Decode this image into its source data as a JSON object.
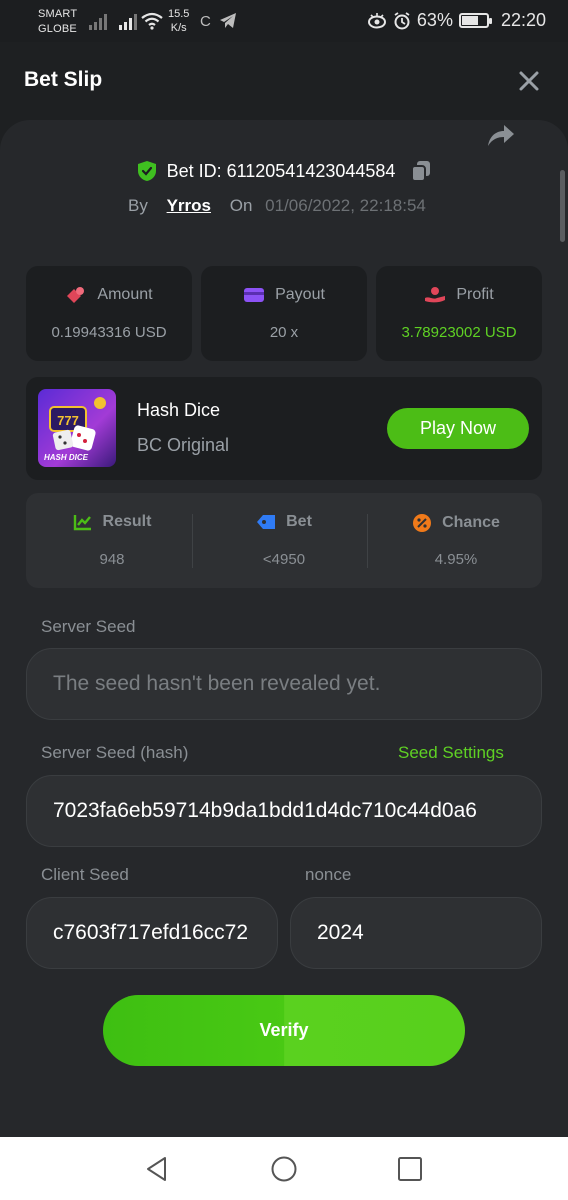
{
  "status_bar": {
    "carrier_line1": "SMART",
    "carrier_line2": "GLOBE",
    "speed_value": "15.5",
    "speed_unit": "K/s",
    "extra_letter": "C",
    "battery": "63%",
    "time": "22:20"
  },
  "header": {
    "title": "Bet Slip"
  },
  "bet": {
    "id_text": "Bet ID: 61120541423044584",
    "by_label": "By",
    "user": "Yrros",
    "on_label": "On",
    "date": "01/06/2022, 22:18:54"
  },
  "stats": [
    {
      "label": "Amount",
      "value": "0.19943316 USD",
      "icon": "coins-icon"
    },
    {
      "label": "Payout",
      "value": "20 x",
      "icon": "card-icon"
    },
    {
      "label": "Profit",
      "value": "3.78923002 USD",
      "icon": "hand-coin-icon"
    }
  ],
  "game": {
    "name": "Hash Dice",
    "subtitle": "BC Original",
    "thumb_text": "HASH DICE",
    "play_label": "Play Now"
  },
  "results": [
    {
      "label": "Result",
      "value": "948",
      "icon": "chart-icon",
      "color": "#4cbd16"
    },
    {
      "label": "Bet",
      "value": "<4950",
      "icon": "tag-icon",
      "color": "#2f7bf5"
    },
    {
      "label": "Chance",
      "value": "4.95%",
      "icon": "percent-icon",
      "color": "#f07a1a"
    }
  ],
  "fields": {
    "server_seed_label": "Server Seed",
    "server_seed_placeholder": "The seed hasn't been revealed yet.",
    "server_seed_hash_label": "Server Seed (hash)",
    "seed_settings_label": "Seed Settings",
    "server_seed_hash_value": "7023fa6eb59714b9da1bdd1d4dc710c44d0a6",
    "client_seed_label": "Client Seed",
    "client_seed_value": "c7603f717efd16cc72",
    "nonce_label": "nonce",
    "nonce_value": "2024"
  },
  "verify_label": "Verify",
  "colors": {
    "accent_green": "#4cbd16",
    "background": "#1e2022",
    "card": "#1c1e20"
  }
}
